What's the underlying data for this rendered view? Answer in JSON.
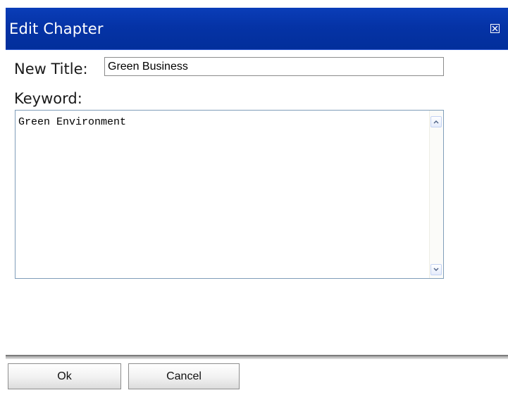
{
  "dialog": {
    "title": "Edit Chapter",
    "close_icon": "close-box-icon"
  },
  "form": {
    "new_title_label": "New Title:",
    "new_title_value": "Green Business",
    "keyword_label": "Keyword:",
    "keyword_value": "Green Environment"
  },
  "buttons": {
    "ok_label": "Ok",
    "cancel_label": "Cancel"
  },
  "colors": {
    "titlebar": "#0533a6",
    "title_text": "#ffffff"
  }
}
